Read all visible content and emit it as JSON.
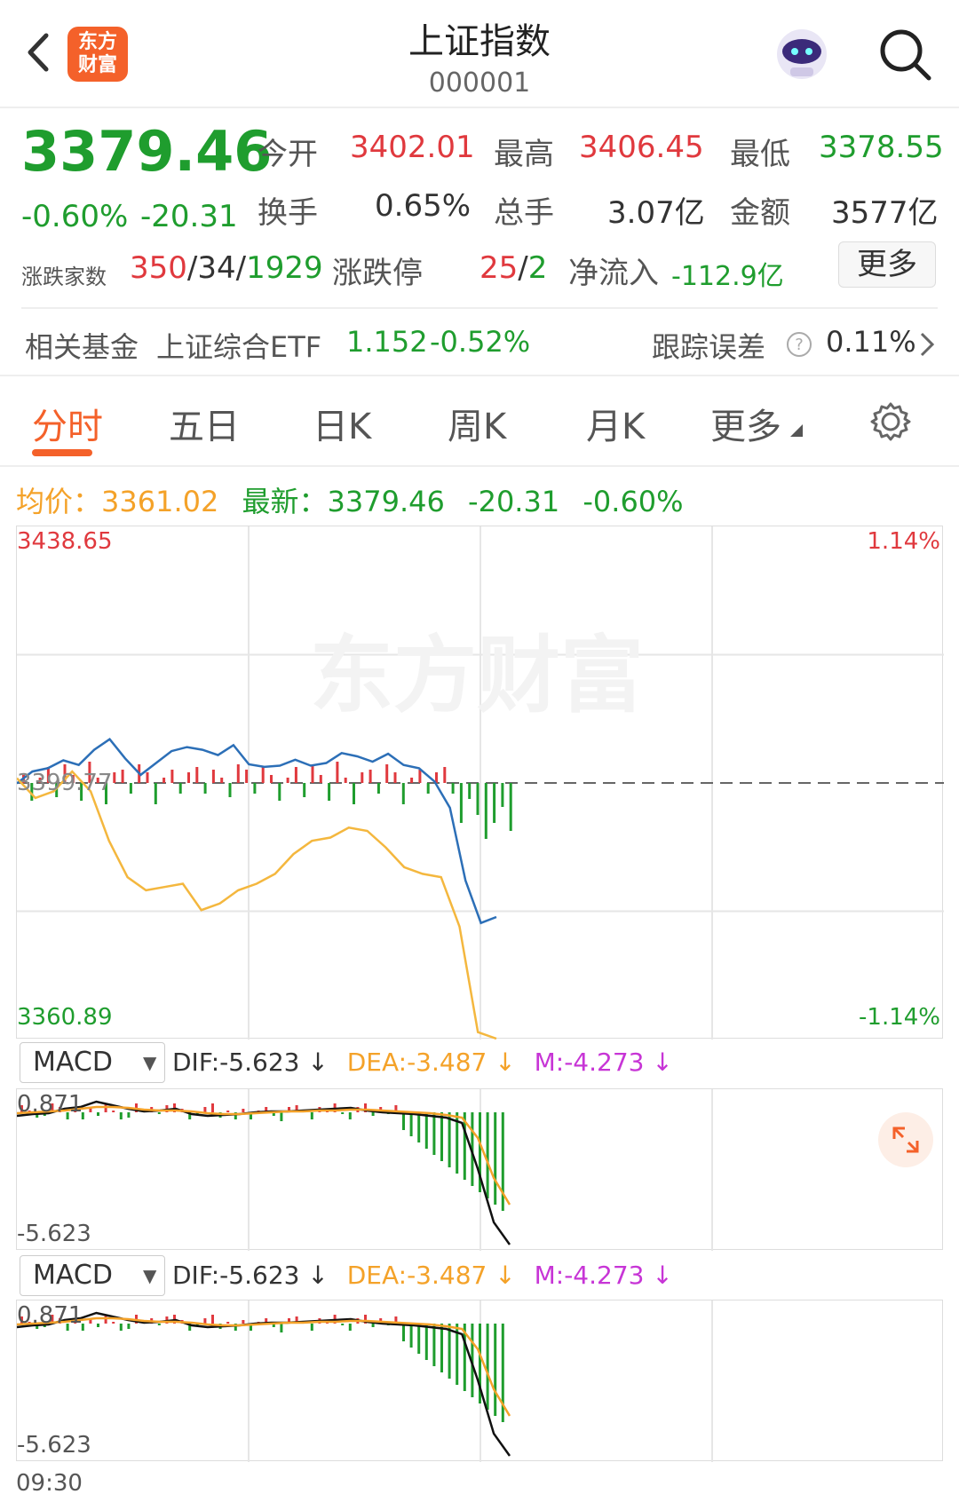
{
  "nav": {
    "title": "上证指数",
    "code": "000001",
    "logo_text_1": "东方",
    "logo_text_2": "财富"
  },
  "quote": {
    "price": "3379.46",
    "change_pct": "-0.60%",
    "change": "-20.31",
    "open_label": "今开",
    "open": "3402.01",
    "high_label": "最高",
    "high": "3406.45",
    "low_label": "最低",
    "low": "3378.55",
    "turnover_label": "换手",
    "turnover": "0.65%",
    "volume_label": "总手",
    "volume": "3.07亿",
    "amount_label": "金额",
    "amount": "3577亿",
    "breadth_label": "涨跌家数",
    "up": "350",
    "sep1": "/",
    "flat": "34",
    "sep2": "/",
    "down": "1929",
    "limit_label": "涨跌停",
    "limit_up": "25",
    "sep3": "/",
    "limit_down": "2",
    "netflow_label": "净流入",
    "netflow": "-112.9亿",
    "more_label": "更多"
  },
  "fund": {
    "label": "相关基金",
    "name": "上证综合ETF",
    "price": "1.152",
    "pct": "-0.52%",
    "track_label": "跟踪误差",
    "track_value": "0.11%"
  },
  "tabs": [
    "分时",
    "五日",
    "日K",
    "周K",
    "月K",
    "更多"
  ],
  "info_bar": {
    "avg_label": "均价：",
    "avg": "3361.02",
    "last_label": "最新：",
    "last": "3379.46",
    "chg": "-20.31",
    "pct": "-0.60%"
  },
  "chart": {
    "y_top": "3438.65",
    "y_bottom": "3360.89",
    "pct_top": "1.14%",
    "pct_bottom": "-1.14%",
    "prev_close": "3399.77",
    "watermark": "东方财富",
    "time_start": "09:30"
  },
  "macd": {
    "selector": "MACD",
    "dif": "DIF:-5.623 ↓",
    "dea": "DEA:-3.487 ↓",
    "m": "M:-4.273 ↓",
    "top": "0.871",
    "bottom": "-5.623"
  },
  "colors": {
    "up": "#e0393e",
    "down": "#1f9d2e",
    "accent": "#f4612a",
    "price_line": "#2c6fb7",
    "avg_line": "#f4b73e",
    "dea": "#f4a229",
    "m": "#c735d6"
  },
  "chart_data": {
    "type": "line",
    "title": "",
    "xlabel": "",
    "ylabel": "",
    "x_start": "09:30",
    "ylim": [
      3360.89,
      3438.65
    ],
    "prev_close": 3399.77,
    "series": [
      {
        "values": [
          3399.7,
          3401.5,
          3402.0,
          3403.2,
          3402.5,
          3404.8,
          3406.4,
          3403.5,
          3401.0,
          3402.8,
          3404.6,
          3405.2,
          3404.8,
          3404.0,
          3405.5,
          3402.6,
          3402.2,
          3402.4,
          3403.3,
          3402.4,
          3402.8,
          3404.3,
          3403.8,
          3403.0,
          3404.2,
          3402.5,
          3402.0,
          3400.0,
          3396.0,
          3385.0,
          3378.55,
          3379.46
        ]
      },
      {
        "values": [
          3400.5,
          3397.5,
          3398.5,
          3401.5,
          3398.5,
          3391.0,
          3385.5,
          3383.5,
          3384.0,
          3384.5,
          3380.5,
          3381.5,
          3383.5,
          3384.5,
          3386.0,
          3389.0,
          3391.0,
          3391.5,
          3393.0,
          3392.5,
          3390.0,
          3387.0,
          3386.0,
          3385.5,
          3378.0,
          3362.0,
          3361.02
        ]
      }
    ]
  }
}
